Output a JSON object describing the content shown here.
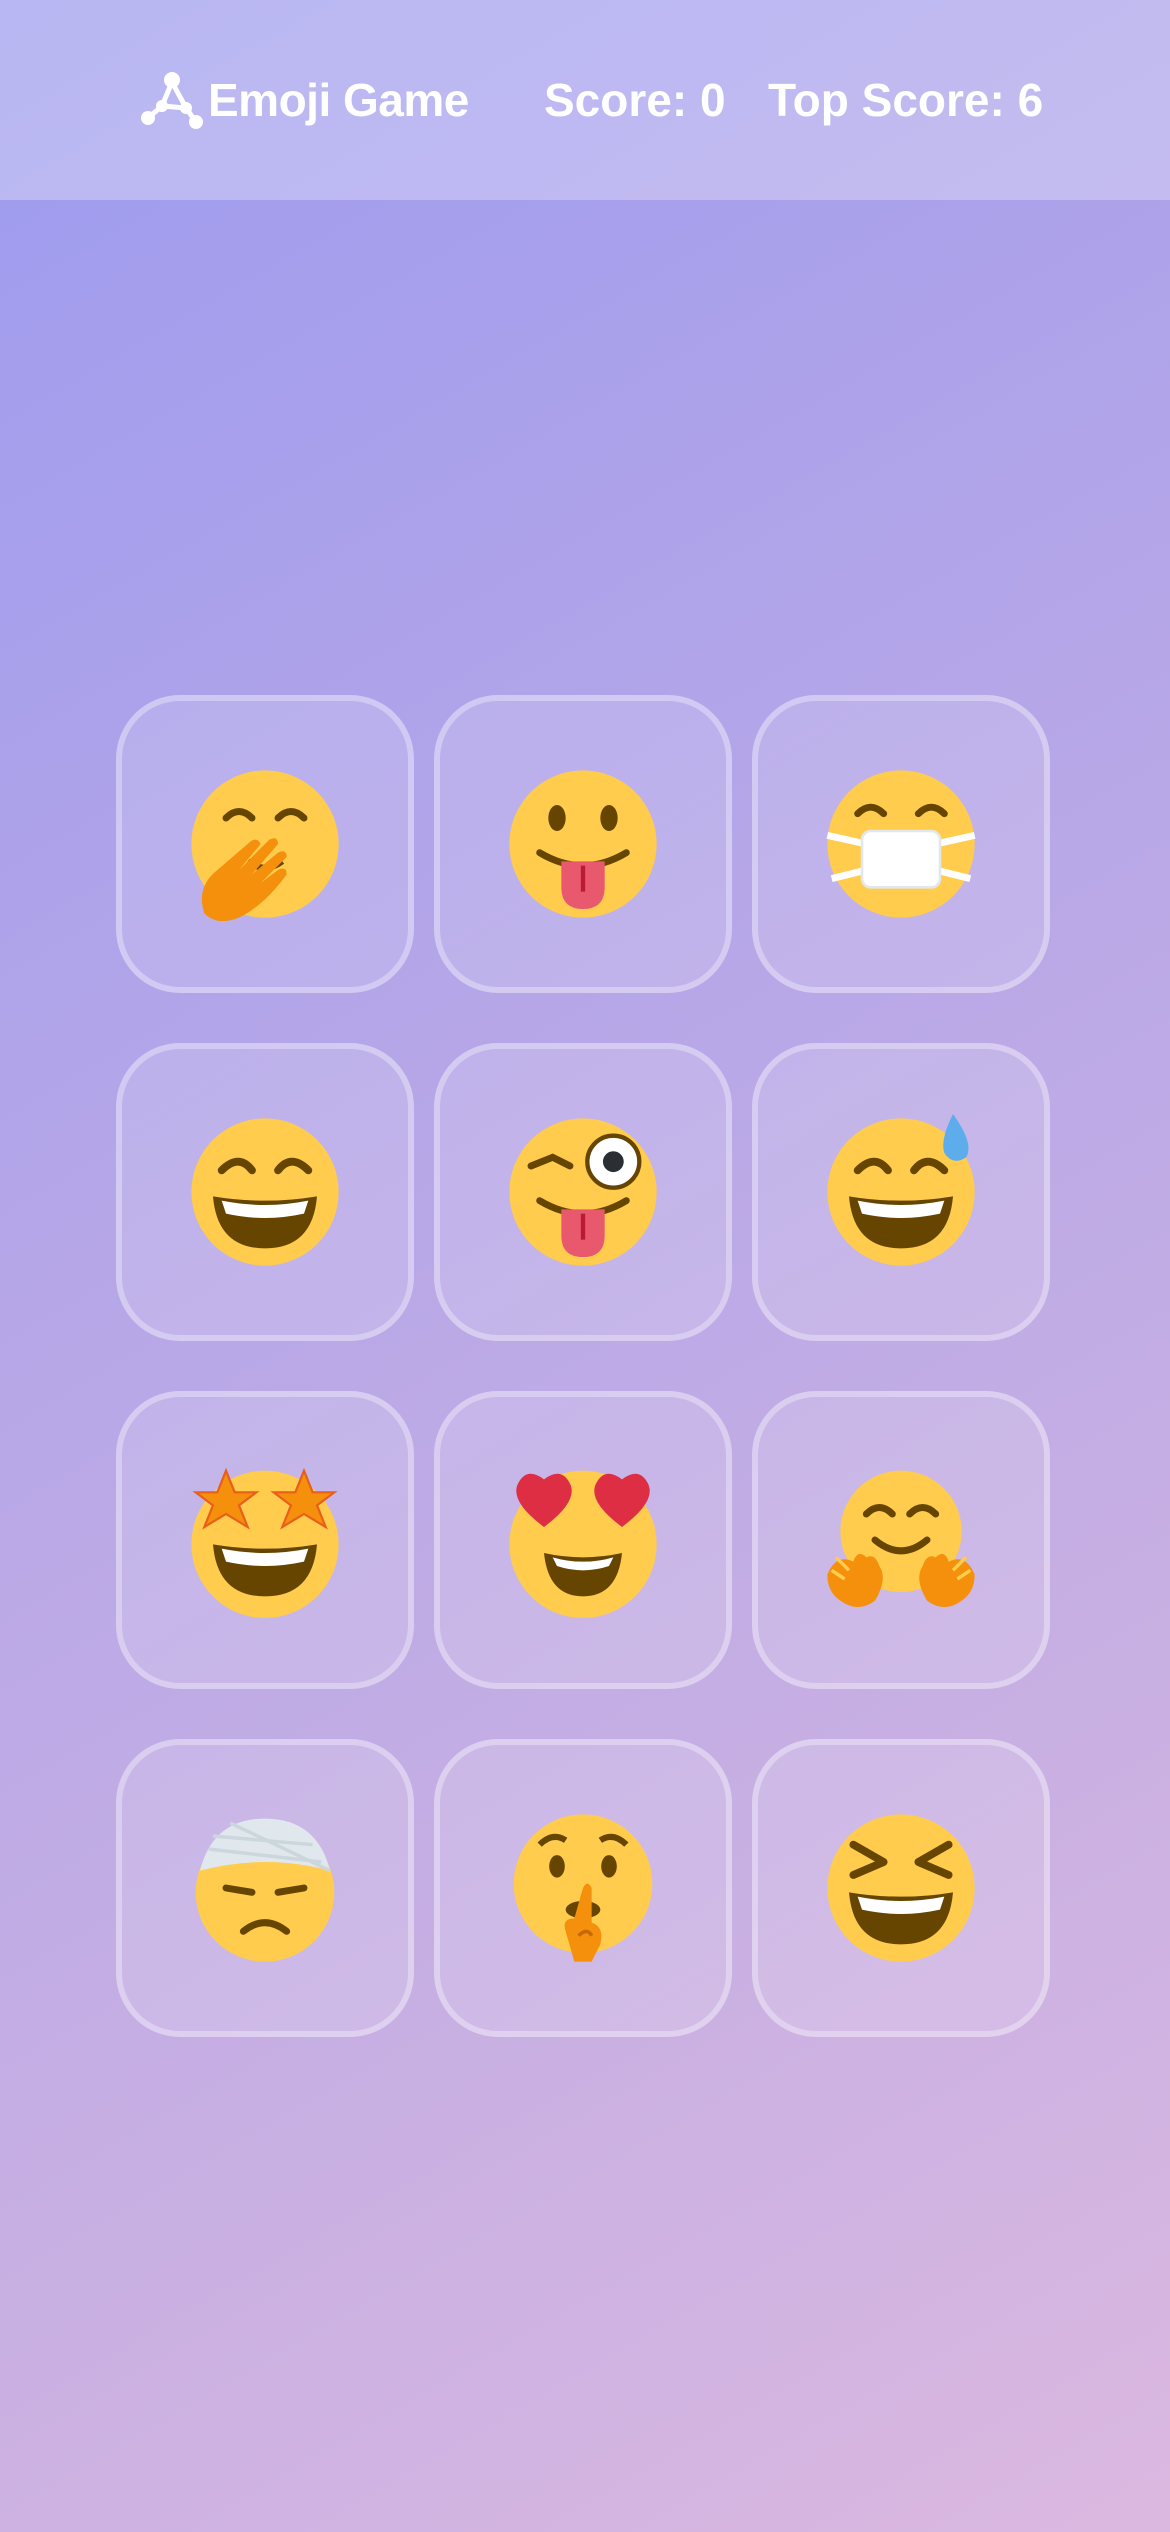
{
  "header": {
    "title": "Emoji Game",
    "score": "Score: 0",
    "top_score": "Top Score: 6"
  },
  "emojis": [
    {
      "name": "face-with-hand-over-mouth"
    },
    {
      "name": "face-with-tongue"
    },
    {
      "name": "face-with-medical-mask"
    },
    {
      "name": "grinning-face-with-smiling-eyes"
    },
    {
      "name": "winking-face-with-tongue"
    },
    {
      "name": "grinning-face-with-sweat"
    },
    {
      "name": "star-struck"
    },
    {
      "name": "smiling-face-with-heart-eyes"
    },
    {
      "name": "hugging-face"
    },
    {
      "name": "face-with-head-bandage"
    },
    {
      "name": "shushing-face"
    },
    {
      "name": "grinning-squinting-face"
    }
  ],
  "colors": {
    "face": "#ffcc4d",
    "dark": "#664500",
    "tongue": "#e8596e",
    "hand": "#f4900c",
    "heart": "#dd2e44",
    "star": "#f4900c"
  }
}
